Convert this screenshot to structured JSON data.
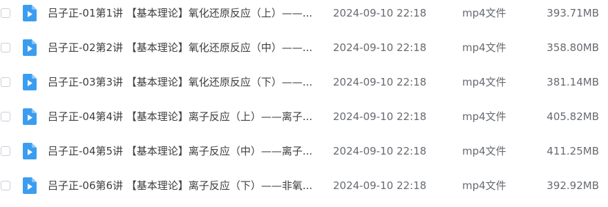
{
  "files": [
    {
      "name": "吕子正-01第1讲 【基本理论】氧化还原反应（上）——...",
      "date": "2024-09-10 22:18",
      "type": "mp4文件",
      "size": "393.71MB",
      "icon": "video-file-icon"
    },
    {
      "name": "吕子正-02第2讲 【基本理论】氧化还原反应（中）——...",
      "date": "2024-09-10 22:18",
      "type": "mp4文件",
      "size": "358.80MB",
      "icon": "video-file-icon"
    },
    {
      "name": "吕子正-03第3讲 【基本理论】氧化还原反应（下）——...",
      "date": "2024-09-10 22:18",
      "type": "mp4文件",
      "size": "381.14MB",
      "icon": "video-file-icon"
    },
    {
      "name": "吕子正-04第4讲 【基本理论】离子反应（上）——离子...",
      "date": "2024-09-10 22:18",
      "type": "mp4文件",
      "size": "405.82MB",
      "icon": "video-file-icon"
    },
    {
      "name": "吕子正-04第5讲 【基本理论】离子反应（中）——离子...",
      "date": "2024-09-10 22:18",
      "type": "mp4文件",
      "size": "411.25MB",
      "icon": "video-file-icon"
    },
    {
      "name": "吕子正-06第6讲 【基本理论】离子反应（下）——非氧...",
      "date": "2024-09-10 22:18",
      "type": "mp4文件",
      "size": "392.92MB",
      "icon": "video-file-icon"
    }
  ],
  "colors": {
    "icon_blue": "#3b9df0",
    "icon_fold": "#8cc7f7"
  }
}
